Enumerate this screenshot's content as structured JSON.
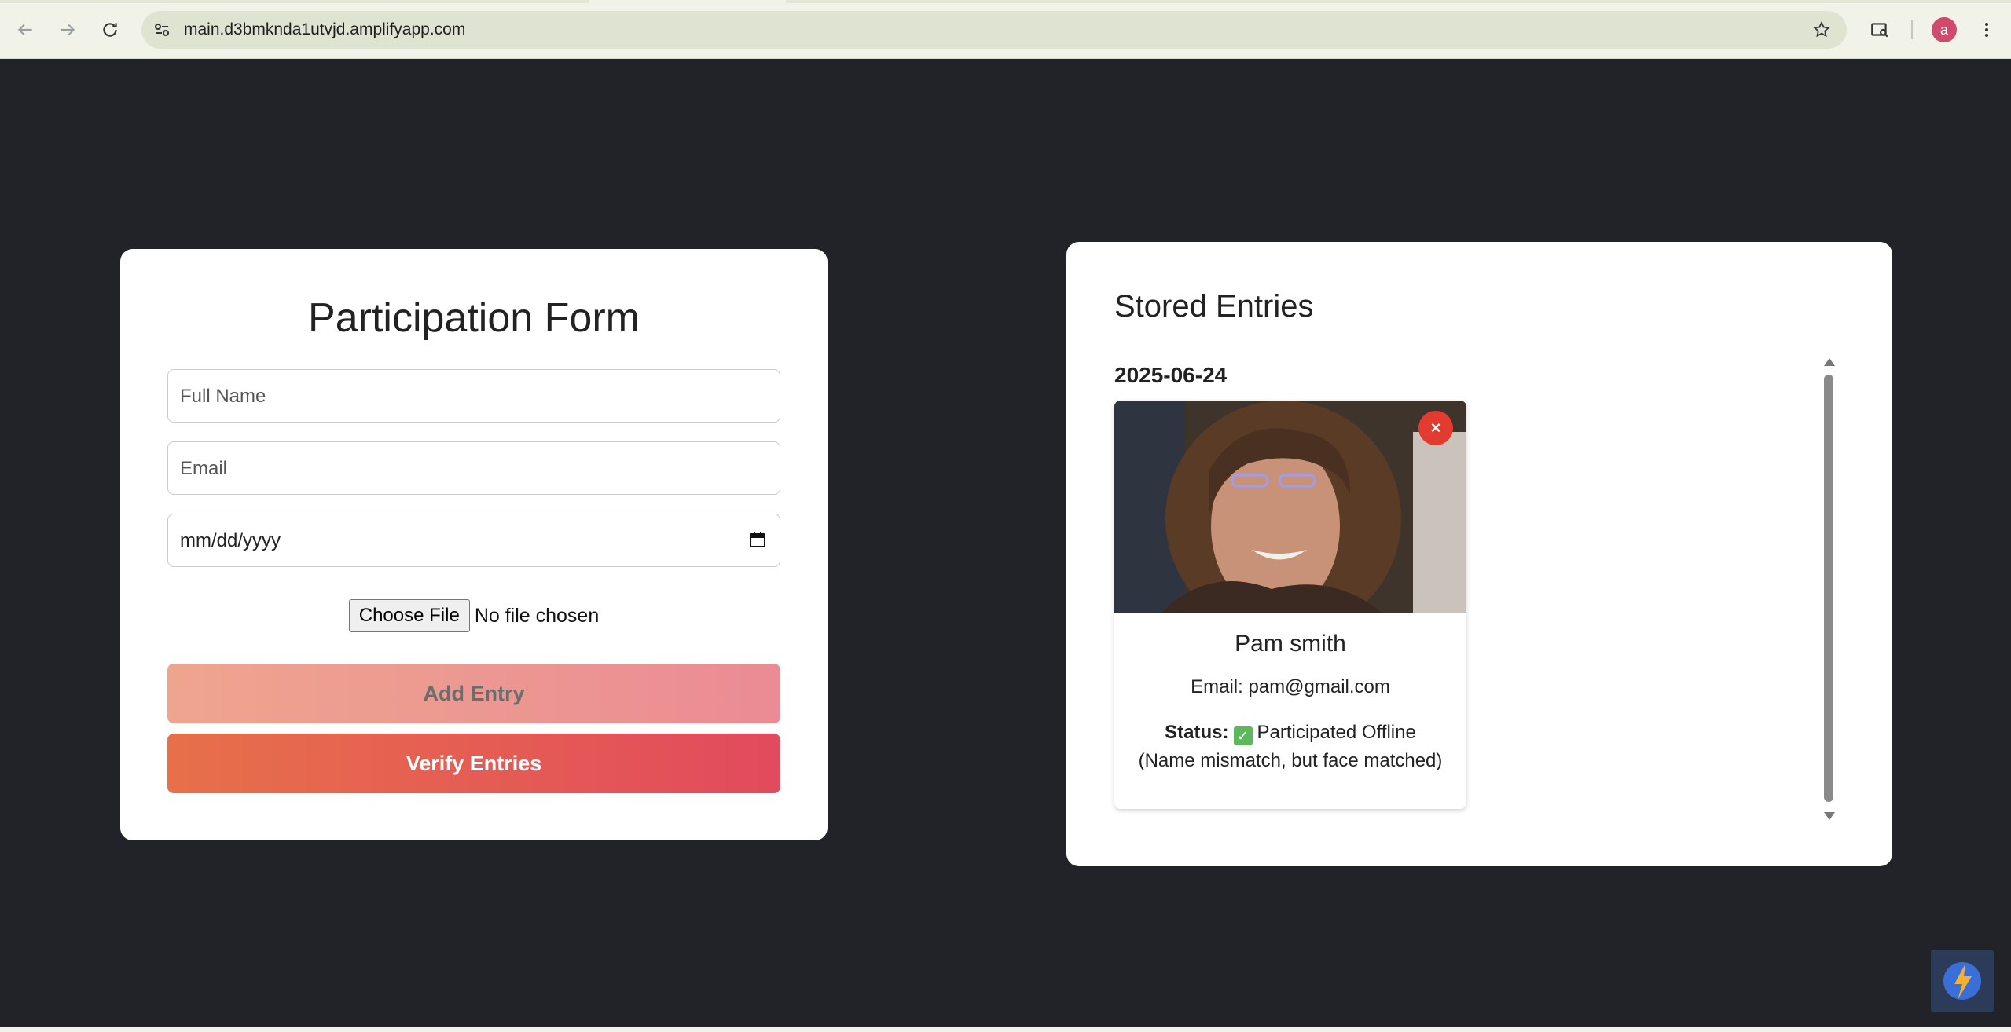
{
  "browser": {
    "url": "main.d3bmknda1utvjd.amplifyapp.com",
    "avatar_letter": "a",
    "icons": [
      "back-icon",
      "forward-icon",
      "reload-icon",
      "site-info-icon",
      "star-icon",
      "search-tab-icon",
      "menu-icon"
    ]
  },
  "form": {
    "title": "Participation Form",
    "name_placeholder": "Full Name",
    "email_placeholder": "Email",
    "date_placeholder": "mm/dd/yyyy",
    "file_button": "Choose File",
    "file_status": "No file chosen",
    "add_button": "Add Entry",
    "verify_button": "Verify Entries"
  },
  "entries": {
    "title": "Stored Entries",
    "groups": [
      {
        "date": "2025-06-24",
        "items": [
          {
            "name": "Pam smith",
            "email_label": "Email: pam@gmail.com",
            "status_label": "Status:",
            "status_text": "Participated Offline",
            "status_note": "(Name mismatch, but face matched)",
            "delete_label": "×"
          }
        ]
      }
    ]
  },
  "colors": {
    "page_bg": "#212328",
    "verify_gradient": [
      "#e7704a",
      "#e24a5d"
    ],
    "add_gradient": [
      "#eea58e",
      "#eb8b95"
    ],
    "delete_button": "#e23b2f",
    "status_check": "#5cb85c"
  }
}
